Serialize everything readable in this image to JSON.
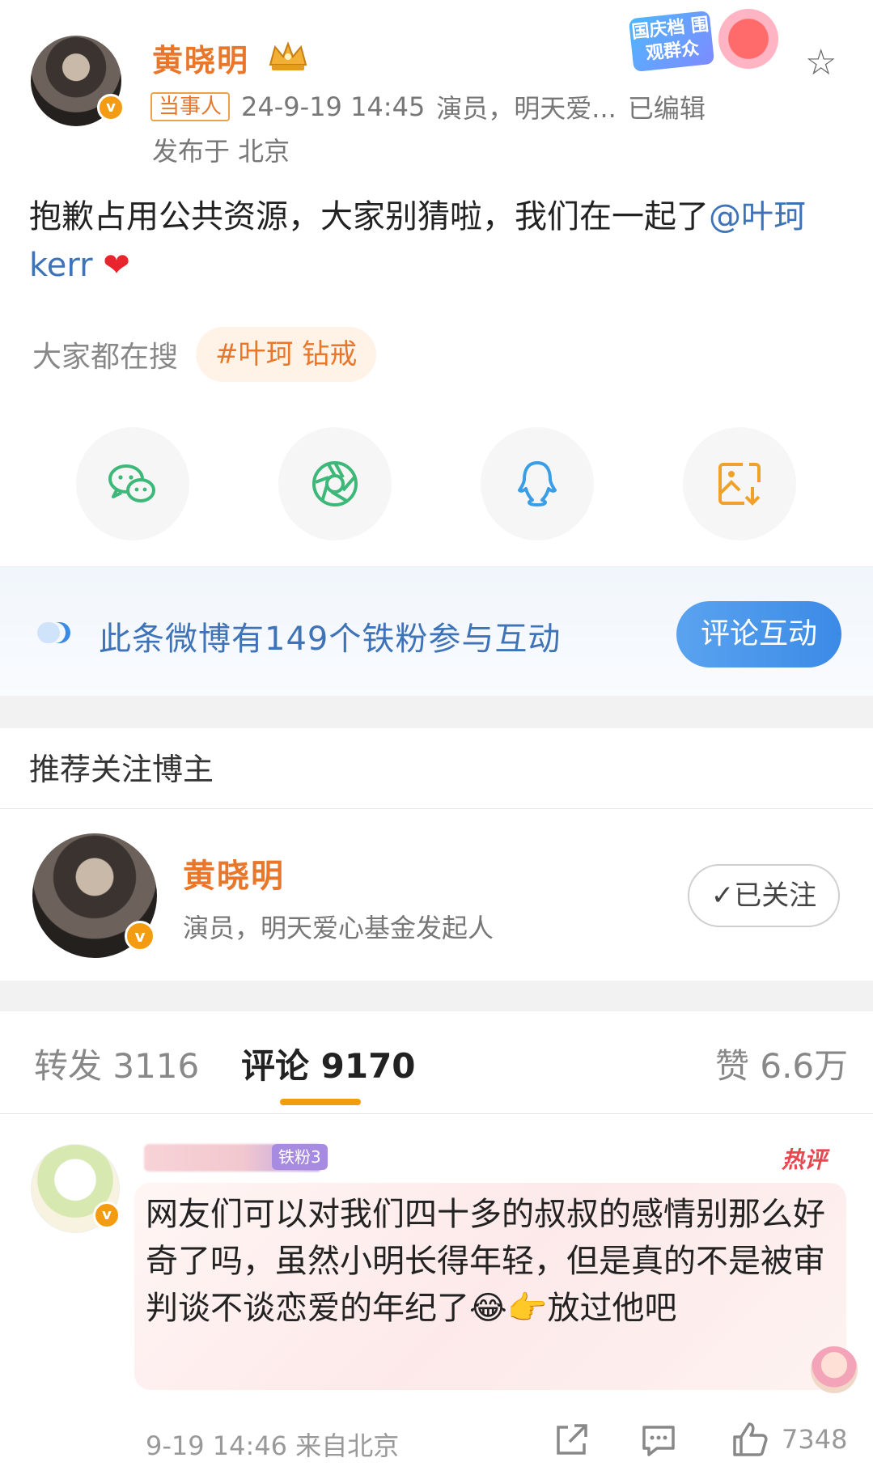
{
  "post": {
    "author": "黄晓明",
    "tag": "当事人",
    "time": "24-9-19 14:45",
    "author_desc_short": "演员，明天爱...",
    "edited": "已编辑",
    "location": "发布于 北京",
    "content_text": "抱歉占用公共资源，大家别猜啦，我们在一起了",
    "mention": "@叶珂kerr",
    "emoji": "heart-emoji",
    "event_badge": "国庆档 围观群众"
  },
  "hot_search": {
    "label": "大家都在搜",
    "chip": "#叶珂 钻戒"
  },
  "share": {
    "icons": [
      "wechat-icon",
      "moments-icon",
      "qq-icon",
      "save-image-icon"
    ]
  },
  "fans": {
    "text": "此条微博有149个铁粉参与互动",
    "button": "评论互动"
  },
  "recommend": {
    "title": "推荐关注博主",
    "name": "黄晓明",
    "desc": "演员，明天爱心基金发起人",
    "follow_label": "✓已关注"
  },
  "tabs": {
    "repost": "转发 3116",
    "comment": "评论 9170",
    "like": "赞 6.6万"
  },
  "comment": {
    "user_badge": "铁粉3",
    "hot_tag": "热评",
    "text": "网友们可以对我们四十多的叔叔的感情别那么好奇了吗，虽然小明长得年轻，但是真的不是被审判谈不谈恋爱的年纪了😂👉放过他吧",
    "meta": "9-19 14:46 来自北京",
    "likes": "7348"
  },
  "colors": {
    "brand_orange": "#e8762b",
    "link_blue": "#3f73b8",
    "button_blue": "#3b8ae6",
    "hot_red": "#e8474f"
  }
}
